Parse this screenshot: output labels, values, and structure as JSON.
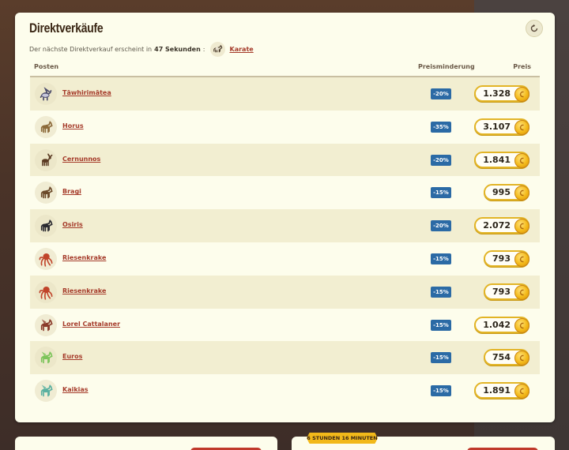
{
  "panel": {
    "title": "Direktverkäufe",
    "subtitle_prefix": "Der nächste Direktverkauf erscheint in",
    "countdown": "47 Sekunden",
    "subtitle_sep": ":",
    "next_item": "Karate"
  },
  "table": {
    "headers": {
      "item": "Posten",
      "discount": "Preisminderung",
      "price": "Preis"
    },
    "rows": [
      {
        "name": "Tāwhirimātea",
        "discount": "-20%",
        "price": "1.328",
        "icon": "dragon-icon",
        "color": "#4a4a6a"
      },
      {
        "name": "Horus",
        "discount": "-35%",
        "price": "3.107",
        "icon": "horse-icon",
        "color": "#8c6a3a"
      },
      {
        "name": "Cernunnos",
        "discount": "-20%",
        "price": "1.841",
        "icon": "stag-icon",
        "color": "#5a3a22"
      },
      {
        "name": "Bragi",
        "discount": "-15%",
        "price": "995",
        "icon": "horse-icon",
        "color": "#6b4a2a"
      },
      {
        "name": "Osiris",
        "discount": "-20%",
        "price": "2.072",
        "icon": "horse-icon",
        "color": "#2a2a30"
      },
      {
        "name": "Riesenkrake",
        "discount": "-15%",
        "price": "793",
        "icon": "kraken-icon",
        "color": "#c0442a"
      },
      {
        "name": "Riesenkrake",
        "discount": "-15%",
        "price": "793",
        "icon": "kraken-icon",
        "color": "#c0442a"
      },
      {
        "name": "Lorel Cattalaner",
        "discount": "-15%",
        "price": "1.042",
        "icon": "pegasus-icon",
        "color": "#8a3a2a"
      },
      {
        "name": "Euros",
        "discount": "-15%",
        "price": "754",
        "icon": "pegasus-icon",
        "color": "#7cc45a"
      },
      {
        "name": "Kaikias",
        "discount": "-15%",
        "price": "1.891",
        "icon": "pegasus-icon",
        "color": "#5ab0a0"
      }
    ]
  },
  "bottom": {
    "timer": "6 STUNDEN 16 MINUTEN"
  },
  "colors": {
    "accent": "#a53b2a",
    "discount_badge": "#2b6aa5",
    "coin": "#f3b919",
    "panel_bg": "#fdfdec"
  }
}
